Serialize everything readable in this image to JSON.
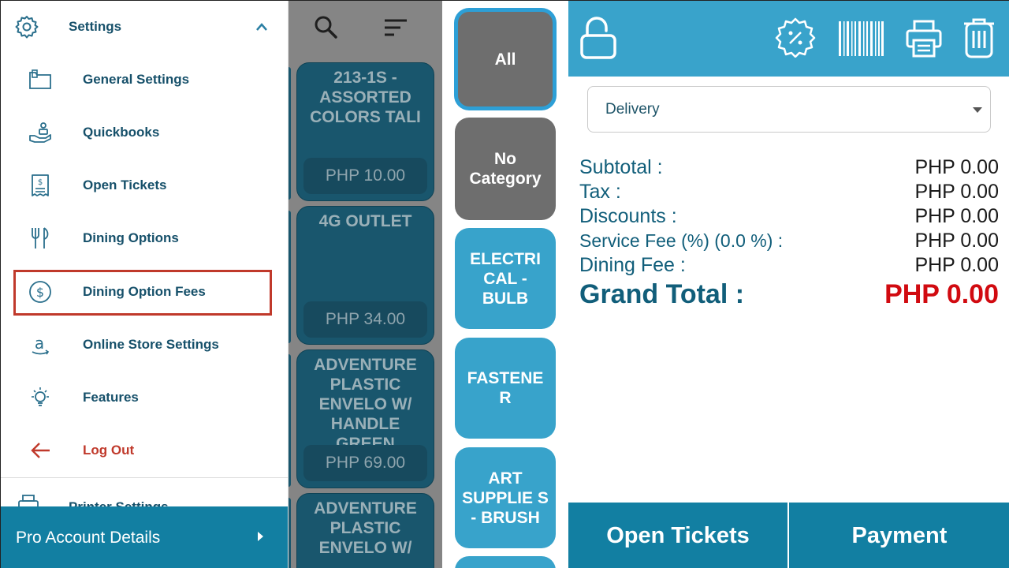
{
  "drawer": {
    "header_title": "Settings",
    "items": [
      {
        "label": "General Settings",
        "icon": "general-settings-icon"
      },
      {
        "label": "Quickbooks",
        "icon": "quickbooks-icon"
      },
      {
        "label": "Open Tickets",
        "icon": "receipt-icon"
      },
      {
        "label": "Dining Options",
        "icon": "fork-knife-icon"
      },
      {
        "label": "Dining Option Fees",
        "icon": "dollar-circle-icon",
        "highlighted": true
      },
      {
        "label": "Online Store Settings",
        "icon": "online-store-icon"
      },
      {
        "label": "Features",
        "icon": "lightbulb-icon"
      },
      {
        "label": "Log Out",
        "icon": "arrow-left-icon"
      }
    ],
    "printer_settings_label": "Printer Settings",
    "pro_account_label": "Pro Account Details"
  },
  "products": [
    {
      "name": "213-1S - ASSORTED COLORS TALI",
      "price": "PHP 10.00"
    },
    {
      "name": "4G OUTLET",
      "price": "PHP 34.00"
    },
    {
      "name": "ADVENTURE PLASTIC ENVELO W/ HANDLE GREEN",
      "price": "PHP 69.00"
    },
    {
      "name": "ADVENTURE PLASTIC ENVELO W/",
      "price": ""
    }
  ],
  "categories": [
    {
      "label": "All",
      "selected": true
    },
    {
      "label": "No Category"
    },
    {
      "label": "ELECTRI CAL - BULB"
    },
    {
      "label": "FASTENE R"
    },
    {
      "label": "ART SUPPLIE S - BRUSH"
    }
  ],
  "order": {
    "order_type": "Delivery",
    "rows": [
      {
        "label": "Subtotal :",
        "amount": "PHP 0.00"
      },
      {
        "label": "Tax :",
        "amount": "PHP 0.00"
      },
      {
        "label": "Discounts :",
        "amount": "PHP 0.00"
      },
      {
        "label": "Service Fee (%) (0.0 %) :",
        "amount": "PHP 0.00"
      },
      {
        "label": "Dining Fee :",
        "amount": "PHP 0.00"
      }
    ],
    "grand_total_label": "Grand Total :",
    "grand_total_amount": "PHP 0.00",
    "open_tickets_button": "Open Tickets",
    "payment_button": "Payment"
  },
  "colors": {
    "primary": "#39a3cb",
    "primary_dark": "#127fa2",
    "text_dark_blue": "#16506a",
    "danger": "#c0392b",
    "grand_total_red": "#d10a10"
  }
}
